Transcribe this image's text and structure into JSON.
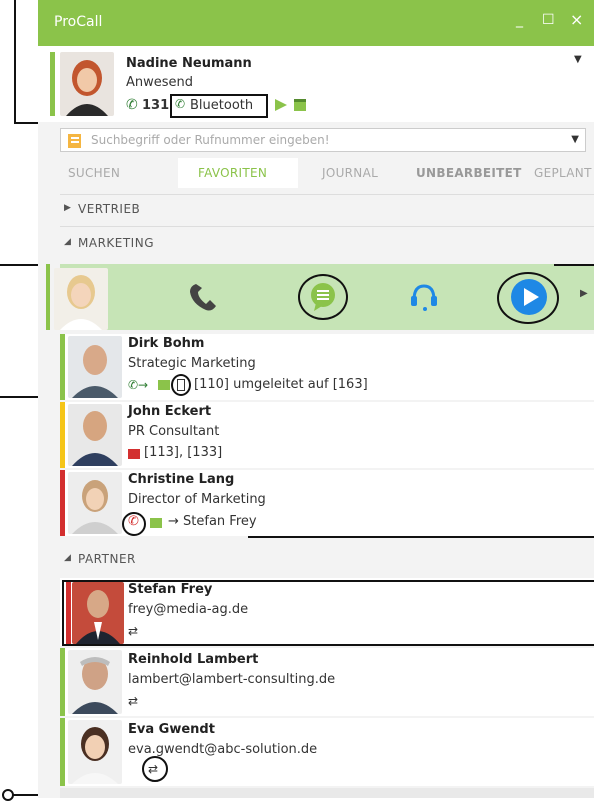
{
  "app": {
    "title": "ProCall"
  },
  "window_controls": {
    "minimize": "_",
    "maximize": "☐",
    "close": "×"
  },
  "user": {
    "name": "Nadine Neumann",
    "status": "Anwesend",
    "extension": "131",
    "device": "Bluetooth"
  },
  "search": {
    "placeholder": "Suchbegriff oder Rufnummer eingeben!"
  },
  "tabs": [
    "SUCHEN",
    "FAVORITEN",
    "JOURNAL",
    "UNBEARBEITET",
    "GEPLANT"
  ],
  "groups": {
    "vertrieb": "VERTRIEB",
    "marketing": "MARKETING",
    "partner": "PARTNER"
  },
  "contacts": [
    {
      "name": "Dirk Bohm",
      "line2": "Strategic Marketing",
      "line3": "[110] umgeleitet auf [163]"
    },
    {
      "name": "John Eckert",
      "line2": "PR Consultant",
      "line3": "[113], [133]"
    },
    {
      "name": "Christine Lang",
      "line2": "Director of Marketing",
      "line3": "→ Stefan Frey"
    },
    {
      "name": "Stefan Frey",
      "line2": "frey@media-ag.de"
    },
    {
      "name": "Reinhold Lambert",
      "line2": "lambert@lambert-consulting.de"
    },
    {
      "name": "Eva Gwendt",
      "line2": "eva.gwendt@abc-solution.de"
    }
  ],
  "colors": {
    "accent": "#8bc34a",
    "present": "#8bc34a",
    "busy": "#d32f2f",
    "away": "#f5c518",
    "action_blue": "#1e88e5"
  }
}
